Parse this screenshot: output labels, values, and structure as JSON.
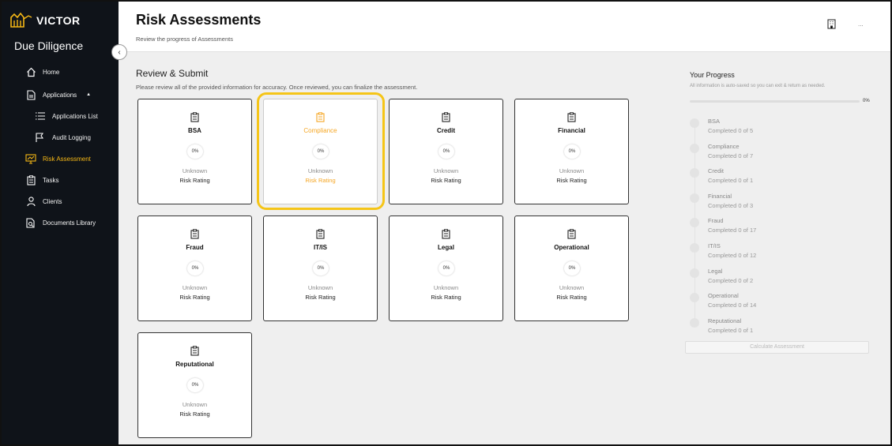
{
  "brand": {
    "name": "VICTOR",
    "app_title": "Due Diligence",
    "accent": "#f5b715"
  },
  "nav": {
    "home": "Home",
    "applications": "Applications",
    "applications_list": "Applications List",
    "audit_logging": "Audit Logging",
    "risk_assessment": "Risk Assessment",
    "tasks": "Tasks",
    "clients": "Clients",
    "documents_library": "Documents Library"
  },
  "header": {
    "title": "Risk Assessments",
    "subtitle": "Review the progress of Assessments",
    "more": "..."
  },
  "main": {
    "section_title": "Review & Submit",
    "section_desc": "Please review all of the provided information for accuracy. Once reviewed, you can finalize the assessment."
  },
  "cards": [
    {
      "name": "BSA",
      "percent": "0%",
      "status": "Unknown",
      "rating_label": "Risk Rating"
    },
    {
      "name": "Compliance",
      "percent": "0%",
      "status": "Unknown",
      "rating_label": "Risk Rating"
    },
    {
      "name": "Credit",
      "percent": "0%",
      "status": "Unknown",
      "rating_label": "Risk Rating"
    },
    {
      "name": "Financial",
      "percent": "0%",
      "status": "Unknown",
      "rating_label": "Risk Rating"
    },
    {
      "name": "Fraud",
      "percent": "0%",
      "status": "Unknown",
      "rating_label": "Risk Rating"
    },
    {
      "name": "IT/IS",
      "percent": "0%",
      "status": "Unknown",
      "rating_label": "Risk Rating"
    },
    {
      "name": "Legal",
      "percent": "0%",
      "status": "Unknown",
      "rating_label": "Risk Rating"
    },
    {
      "name": "Operational",
      "percent": "0%",
      "status": "Unknown",
      "rating_label": "Risk Rating"
    },
    {
      "name": "Reputational",
      "percent": "0%",
      "status": "Unknown",
      "rating_label": "Risk Rating"
    }
  ],
  "progress": {
    "title": "Your Progress",
    "desc": "All information is auto-saved so you can exit & return as needed.",
    "percent": "0%",
    "steps": [
      {
        "name": "BSA",
        "count": "Completed 0 of 5"
      },
      {
        "name": "Compliance",
        "count": "Completed 0 of 7"
      },
      {
        "name": "Credit",
        "count": "Completed 0 of 1"
      },
      {
        "name": "Financial",
        "count": "Completed 0 of 3"
      },
      {
        "name": "Fraud",
        "count": "Completed 0 of 17"
      },
      {
        "name": "IT/IS",
        "count": "Completed 0 of 12"
      },
      {
        "name": "Legal",
        "count": "Completed 0 of 2"
      },
      {
        "name": "Operational",
        "count": "Completed 0 of 14"
      },
      {
        "name": "Reputational",
        "count": "Completed 0 of 1"
      }
    ],
    "button": "Calculate Assessment"
  }
}
